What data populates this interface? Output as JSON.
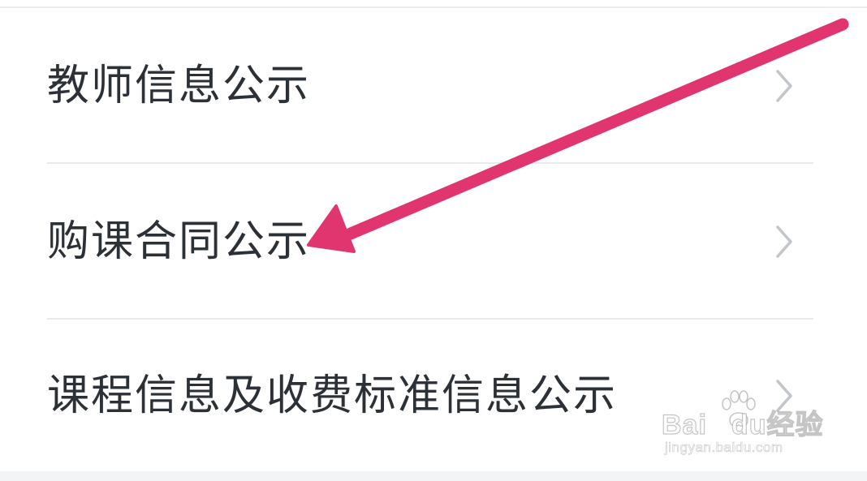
{
  "menu": {
    "items": [
      {
        "label": "教师信息公示",
        "icon": "chevron-right-icon"
      },
      {
        "label": "购课合同公示",
        "icon": "chevron-right-icon"
      },
      {
        "label": "课程信息及收费标准信息公示",
        "icon": "chevron-right-icon"
      }
    ]
  },
  "annotation": {
    "arrow_color": "#e0356f",
    "points_to": "购课合同公示"
  },
  "watermark": {
    "brand_left": "Bai",
    "brand_right": "du",
    "suffix": "经验",
    "url": "jingyan.baidu.com"
  },
  "colors": {
    "text": "#2c3037",
    "chevron": "#c2c5cc",
    "divider": "#e9eaed",
    "background": "#ffffff"
  }
}
